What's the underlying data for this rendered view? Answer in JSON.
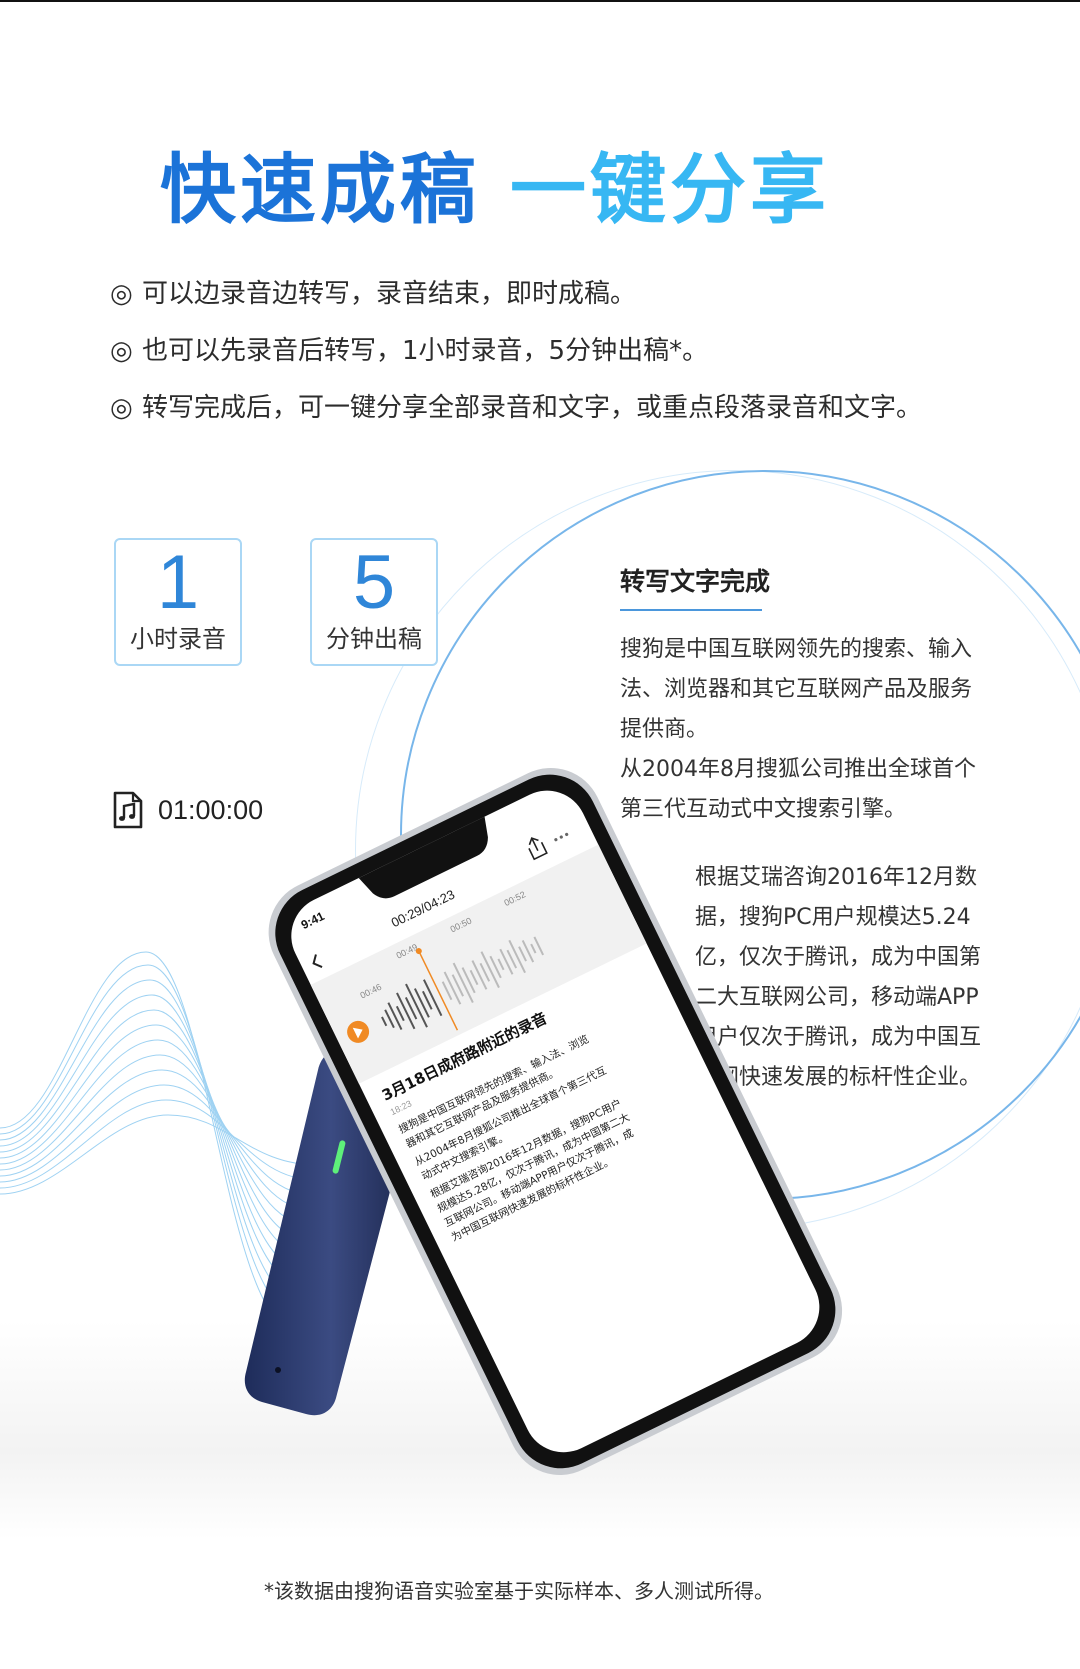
{
  "headline": {
    "part1": "快速成稿",
    "part2": "一键分享"
  },
  "features": [
    {
      "bullet": "◎",
      "text": "可以边录音边转写，录音结束，即时成稿。"
    },
    {
      "bullet": "◎",
      "text": "也可以先录音后转写，1小时录音，5分钟出稿*。"
    },
    {
      "bullet": "◎",
      "text": "转写完成后，可一键分享全部录音和文字，或重点段落录音和文字。"
    }
  ],
  "stats": [
    {
      "number": "1",
      "label": "小时录音"
    },
    {
      "number": "5",
      "label": "分钟出稿"
    }
  ],
  "recording": {
    "icon": "audio-file-icon",
    "duration": "01:00:00"
  },
  "transcript": {
    "title": "转写文字完成",
    "para1": [
      "搜狗是中国互联网领先的搜索、输入",
      "法、浏览器和其它互联网产品及服务",
      "提供商。",
      "从2004年8月搜狐公司推出全球首个",
      "第三代互动式中文搜索引擎。"
    ],
    "para2": [
      "根据艾瑞咨询2016年12月数",
      "据，搜狗PC用户规模达5.24",
      "亿，仅次于腾讯，成为中国第",
      "二大互联网公司，移动端APP",
      "用户仅次于腾讯，成为中国互",
      "联网快速发展的标杆性企业。"
    ]
  },
  "phone_screen": {
    "status_time": "9:41",
    "playback_time": "00:29/04:23",
    "timeline_marks": [
      "00:46",
      "00:49",
      "00:50",
      "00:52"
    ],
    "wave_start_mark": "00:46",
    "recording_title": "3月18日成府路附近的录音",
    "recording_subtime": "18:23",
    "body_lines": [
      "搜狗是中国互联网领先的搜索、输入法、浏览",
      "器和其它互联网产品及服务提供商。",
      "从2004年8月搜狐公司推出全球首个第三代互",
      "动式中文搜索引擎。",
      "根据艾瑞咨询2016年12月数据，搜狗PC用户",
      "规模达5.28亿，仅次于腾讯，成为中国第二大",
      "互联网公司。移动端APP用户仅次于腾讯，成",
      "为中国互联网快速发展的标杆性企业。"
    ],
    "back_icon": "back-chevron-icon",
    "share_icon": "share-icon",
    "more_icon": "more-dots-icon",
    "play_icon": "play-icon"
  },
  "footnote": "*该数据由搜狗语音实验室基于实际样本、多人测试所得。",
  "colors": {
    "primary_blue": "#1b73d8",
    "light_blue": "#37b7f3",
    "accent_orange": "#f08a24",
    "led_green": "#5ef07a"
  }
}
